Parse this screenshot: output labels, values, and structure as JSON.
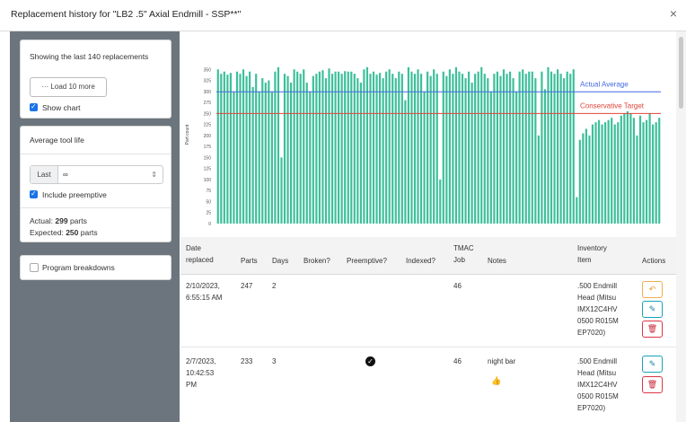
{
  "modal": {
    "title": "Replacement history for \"LB2 .5\" Axial Endmill - SSP**\"",
    "close_label": "×"
  },
  "sidebar": {
    "showing_text": "Showing the last 140 replacements",
    "load_more_label": "··· Load 10 more",
    "show_chart_label": "Show chart",
    "avg_header": "Average tool life",
    "last_prefix": "Last",
    "last_value": "∞",
    "include_preemptive_label": "Include preemptive",
    "actual_prefix": "Actual:",
    "actual_value": "299",
    "actual_suffix": "parts",
    "expected_prefix": "Expected:",
    "expected_value": "250",
    "expected_suffix": "parts",
    "program_breakdowns_label": "Program breakdowns"
  },
  "chart_data": {
    "type": "bar",
    "ylabel": "Part count",
    "ylim": [
      0,
      375
    ],
    "yticks": [
      "0",
      "25",
      "50",
      "75",
      "100",
      "125",
      "150",
      "175",
      "200",
      "225",
      "250",
      "275",
      "300",
      "325",
      "350"
    ],
    "bar_color": "#3dbf9a",
    "values": [
      350,
      340,
      345,
      338,
      342,
      300,
      345,
      340,
      350,
      335,
      345,
      310,
      340,
      300,
      330,
      320,
      325,
      300,
      345,
      355,
      150,
      340,
      335,
      320,
      350,
      345,
      340,
      350,
      320,
      300,
      335,
      340,
      345,
      348,
      330,
      352,
      340,
      345,
      345,
      340,
      346,
      345,
      345,
      340,
      330,
      320,
      350,
      355,
      340,
      345,
      338,
      342,
      330,
      345,
      350,
      340,
      330,
      345,
      340,
      280,
      355,
      345,
      340,
      350,
      340,
      300,
      345,
      335,
      350,
      340,
      100,
      345,
      335,
      350,
      340,
      355,
      345,
      340,
      330,
      345,
      320,
      340,
      345,
      355,
      340,
      330,
      300,
      340,
      345,
      335,
      350,
      340,
      345,
      330,
      300,
      345,
      350,
      340,
      345,
      345,
      330,
      200,
      345,
      305,
      355,
      345,
      340,
      350,
      340,
      330,
      345,
      340,
      350,
      60,
      190,
      205,
      215,
      200,
      225,
      230,
      235,
      225,
      230,
      235,
      240,
      225,
      230,
      245,
      250,
      255,
      250,
      240,
      200,
      245,
      230,
      235,
      250,
      225,
      230,
      240
    ],
    "reference_lines": [
      {
        "name": "Actual Average",
        "value": 299,
        "color": "#4169e1"
      },
      {
        "name": "Conservative Target",
        "value": 250,
        "color": "#e0443a"
      }
    ]
  },
  "table": {
    "headers": {
      "date": [
        "Date",
        "replaced"
      ],
      "parts": "Parts",
      "days": "Days",
      "broken": "Broken?",
      "preemptive": "Preemptive?",
      "indexed": "Indexed?",
      "tmac": [
        "TMAC",
        "Job"
      ],
      "notes": "Notes",
      "inventory": [
        "Inventory",
        "Item"
      ],
      "actions": "Actions"
    },
    "rows": [
      {
        "date": [
          "2/10/2023,",
          "6:55:15 AM"
        ],
        "parts": "247",
        "days": "2",
        "preemptive_check": false,
        "tmac_job": "46",
        "notes": "",
        "inventory": [
          ".500 Endmill",
          "Head (Mitsu",
          "IMX12C4HV",
          "0500 R015M",
          "EP7020)"
        ],
        "actions": [
          "undo",
          "edit",
          "delete"
        ]
      },
      {
        "date": [
          "2/7/2023,",
          "10:42:53",
          "PM"
        ],
        "parts": "233",
        "days": "3",
        "preemptive_check": true,
        "tmac_job": "46",
        "notes": "night bar",
        "notes_icon": "👍",
        "inventory": [
          ".500 Endmill",
          "Head (Mitsu",
          "IMX12C4HV",
          "0500 R015M",
          "EP7020)"
        ],
        "actions": [
          "edit",
          "delete"
        ]
      }
    ]
  },
  "icons": {
    "undo": "↶",
    "edit": "✎",
    "delete": "🗑",
    "check": "✓"
  }
}
